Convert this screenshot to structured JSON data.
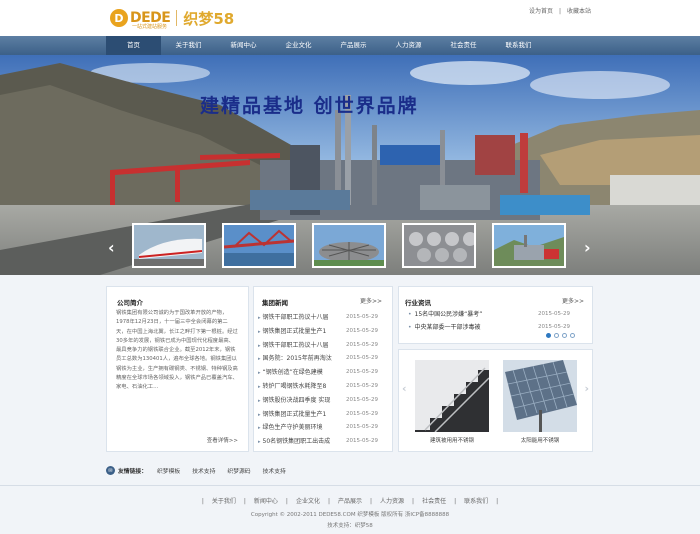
{
  "logo": {
    "mark": "D",
    "brand": "DEDE",
    "sub": "一站式建站服务",
    "name": "织梦58"
  },
  "toplinks": {
    "home": "设为首页",
    "sep": "|",
    "fav": "收藏本站"
  },
  "nav": [
    "首页",
    "关于我们",
    "新闻中心",
    "企业文化",
    "产品展示",
    "人力资源",
    "社会责任",
    "联系我们"
  ],
  "banner": {
    "slogan": "建精品基地  创世界品牌",
    "prev": "‹",
    "next": "›"
  },
  "about": {
    "title": "公司简介",
    "text": "钢铁集团有限公司诚的为于国改革开放的产物，1978年12月23日，十一届三中全会闭幕的第二天，在中国上海北翼，长江之畔打下第一根桩。经过30多年的发展，钢铁已成为中国现代化程度最高、最具竞争力的钢铁联合企业。截至2012年末，钢铁员工总数为130401人，遍布全球各地。钢铁集团以钢铁为主业，生产拥有碳钢类、不锈钢、特种钢及高精度在全球市场各领域投入，钢铁产品已覆盖汽车、家电、石油化工…",
    "more": "查看详情>>"
  },
  "news": {
    "title": "集团新闻",
    "more": "更多>>",
    "items": [
      {
        "t": "钢铁干部职工热议十八届",
        "d": "2015-05-29"
      },
      {
        "t": "钢铁集团正式批量生产1",
        "d": "2015-05-29"
      },
      {
        "t": "钢铁干部职工热议十八届",
        "d": "2015-05-29"
      },
      {
        "t": "国务院：2015年前再淘汰",
        "d": "2015-05-29"
      },
      {
        "t": "“钢铁创造”在绿色建模",
        "d": "2015-05-29"
      },
      {
        "t": "转炉厂喝钢铁水耗降至8",
        "d": "2015-05-29"
      },
      {
        "t": "钢铁股份决战四季度 实现",
        "d": "2015-05-29"
      },
      {
        "t": "钢铁集团正式批量生产1",
        "d": "2015-05-29"
      },
      {
        "t": "绿色生产守护美丽环境",
        "d": "2015-05-29"
      },
      {
        "t": "50名钢铁集团职工出击成",
        "d": "2015-05-29"
      }
    ]
  },
  "industry": {
    "title": "行业资讯",
    "more": "更多>>",
    "items": [
      {
        "t": "15名中国公民涉嫌“暴考”",
        "d": "2015-05-29"
      },
      {
        "t": "中央某部委一干部涉毒被",
        "d": "2015-05-29"
      }
    ]
  },
  "products": {
    "prev": "‹",
    "next": "›",
    "items": [
      {
        "cap": "建筑被用用不锈钢"
      },
      {
        "cap": "太阳能用不锈钢"
      }
    ]
  },
  "friendlinks": {
    "icon": "✉",
    "title": "友情链接：",
    "items": [
      "织梦模板",
      "技术支持",
      "织梦源码",
      "技术支持"
    ]
  },
  "footer": {
    "nav": [
      "关于我们",
      "新闻中心",
      "企业文化",
      "产品展示",
      "人力资源",
      "社会责任",
      "联系我们"
    ],
    "copyright": "Copyright © 2002-2011 DEDE58.COM 织梦模板 版权所有 浙ICP备8888888",
    "tech": "技术支持：织梦58"
  },
  "colors": {
    "nav": "#3c6088",
    "accent": "#2f79c1",
    "brand": "#d8951a"
  }
}
